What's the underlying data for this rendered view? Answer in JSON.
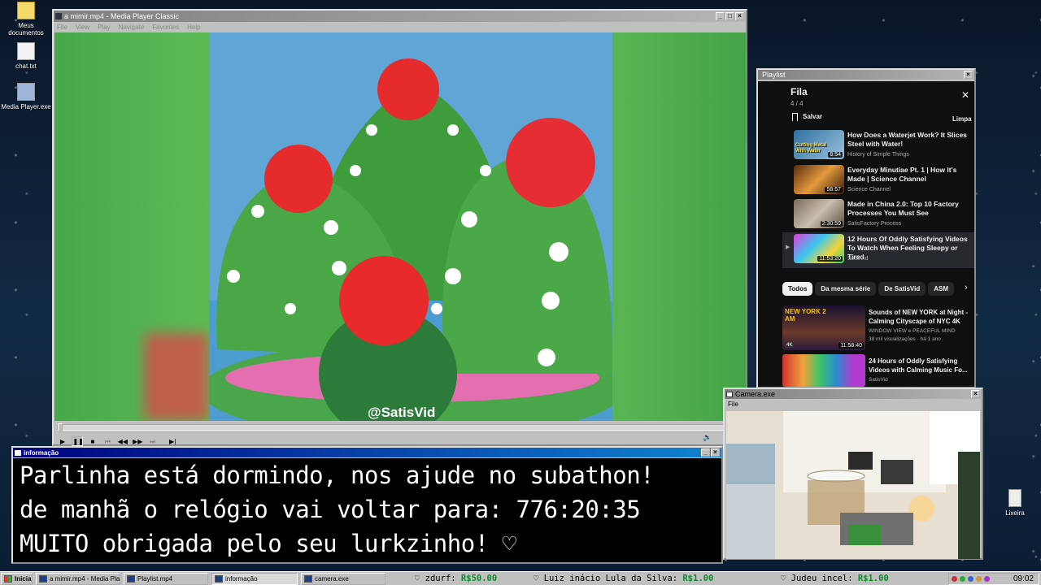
{
  "desktop": {
    "icons": [
      {
        "label": "Meus documentos"
      },
      {
        "label": "chat.txt"
      },
      {
        "label": "Media Player.exe"
      },
      {
        "label": "Lixeira"
      }
    ]
  },
  "player": {
    "title": "a mimir.mp4 - Media Player Classic",
    "menu": [
      "File",
      "View",
      "Play",
      "Navigate",
      "Favorites",
      "Help"
    ],
    "watermark": "@SatisVid",
    "progress": 0.0,
    "controls": [
      "play-icon",
      "pause-icon",
      "stop-icon",
      "prev-icon",
      "rewind-icon",
      "forward-icon",
      "next-icon",
      "frame-step-icon",
      "volume-icon"
    ]
  },
  "playlist": {
    "window_title": "Playlist",
    "header": "Fila",
    "count": "4 / 4",
    "save": "Salvar",
    "clear": "Limpa",
    "queue": [
      {
        "title": "How Does a Waterjet Work? It Slices Steel with Water!",
        "channel": "History of Simple Things",
        "duration": "8:54",
        "thumb_text": "Cutting Metal With Water"
      },
      {
        "title": "Everyday Minutiae Pt. 1 | How It's Made | Science Channel",
        "channel": "Science Channel",
        "duration": "58:57"
      },
      {
        "title": "Made in China 2.0: Top 10 Factory Processes You Must See",
        "channel": "SatisFactory Process",
        "duration": "2:30:59"
      },
      {
        "title": "12 Hours Of Oddly Satisfying Videos To Watch When Feeling Sleepy or Tired",
        "channel": "SatisVid",
        "duration": "11:53:20"
      }
    ],
    "chips": [
      "Todos",
      "Da mesma série",
      "De SatisVid",
      "ASM"
    ],
    "recommended": [
      {
        "title": "Sounds of NEW YORK at Night - Calming Cityscape of NYC 4K",
        "channel": "WINDOW VIEW e PEACEFUL MIND",
        "meta": "38 mil visualizações · há 1 ano",
        "duration": "11:58:40",
        "thumb_text": "NEW YORK 2 AM",
        "badge": "4K"
      },
      {
        "title": "24 Hours of Oddly Satisfying Videos with Calming Music Fo...",
        "channel": "SatisVid",
        "duration": ""
      }
    ]
  },
  "info": {
    "window_title": "informação",
    "lines": [
      "Parlinha está dormindo, nos ajude no subathon!",
      "de manhã o relógio vai voltar para:  776:20:35",
      "MUITO obrigada pelo seu lurkzinho! ♡"
    ]
  },
  "camera": {
    "window_title": "Camera.exe",
    "menu": "File"
  },
  "taskbar": {
    "start": "Iniciar",
    "tasks": [
      {
        "label": "a mimir.mp4 - Media Player..."
      },
      {
        "label": "Playlist.mp4"
      },
      {
        "label": "informação"
      },
      {
        "label": "camera.exe"
      }
    ],
    "ticker": [
      {
        "name": "zdurf:",
        "amount": "R$50.00"
      },
      {
        "name": "Luiz inácio Lula da Silva:",
        "amount": "R$1.00"
      },
      {
        "name": "Judeu incel:",
        "amount": "R$1.00"
      }
    ],
    "clock": "09:02"
  }
}
